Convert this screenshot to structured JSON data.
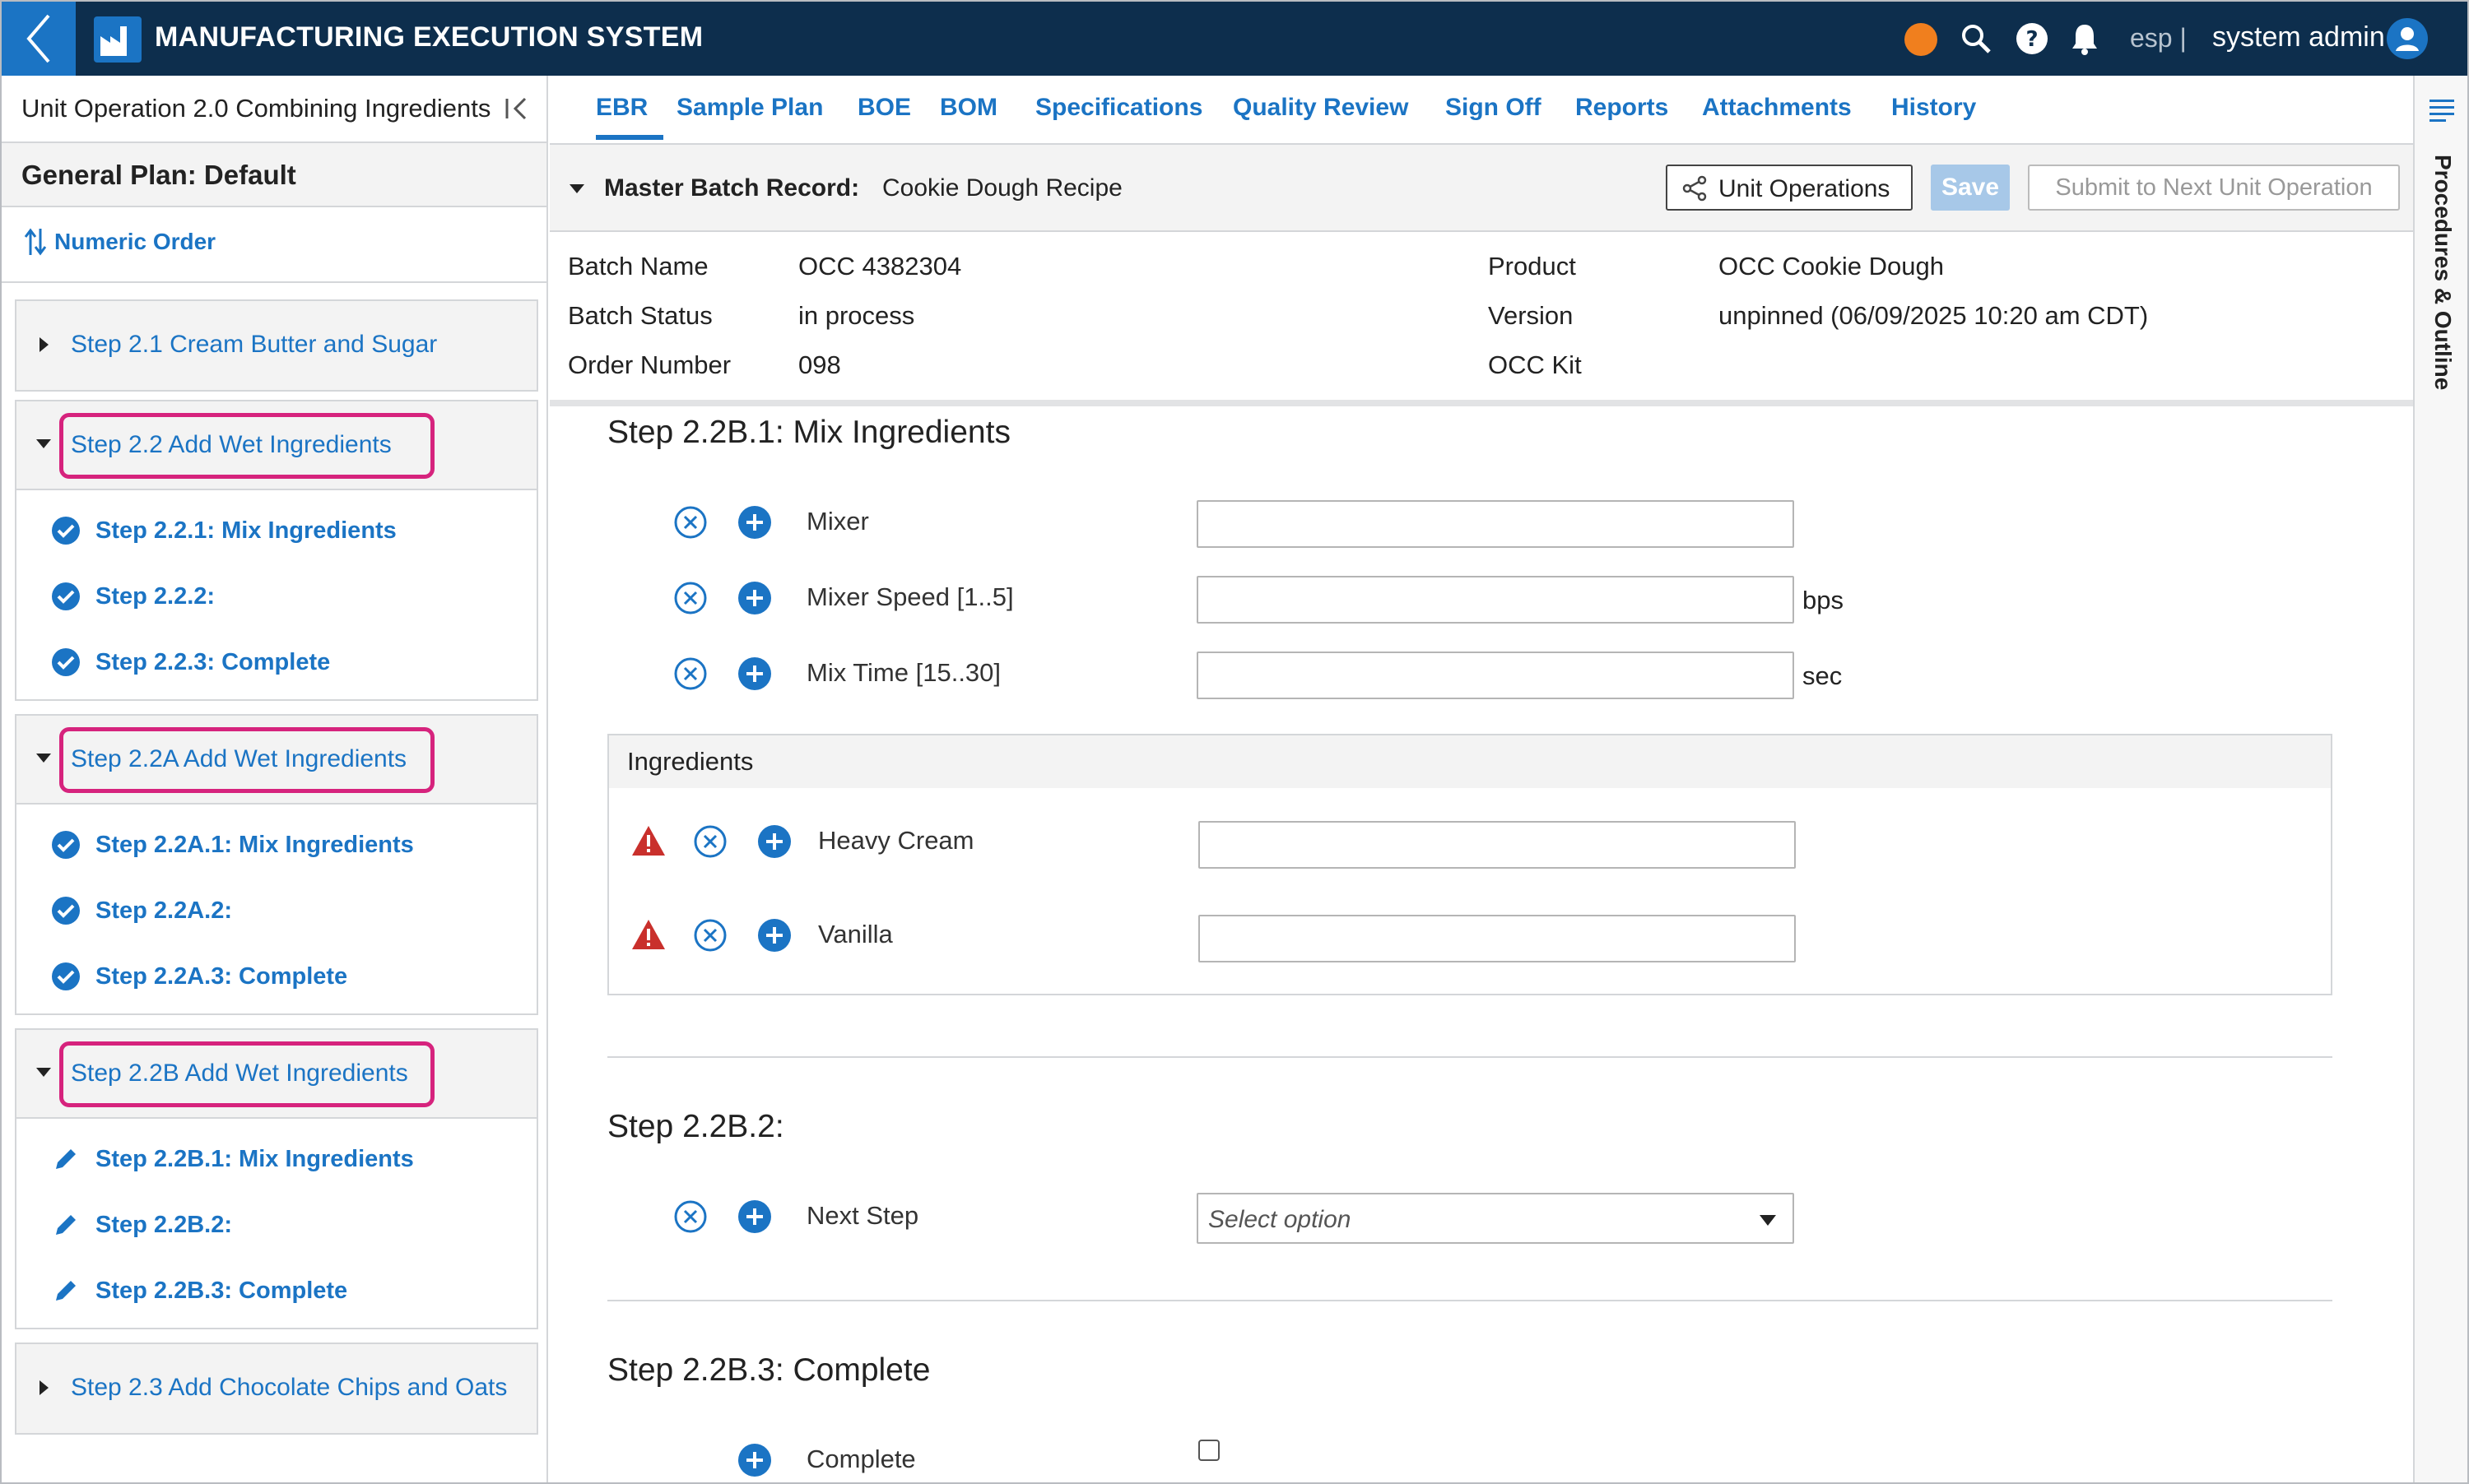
{
  "header": {
    "app_title": "MANUFACTURING EXECUTION SYSTEM",
    "lang": "esp |",
    "user_name": "system admin",
    "status_color": "#f07f1e",
    "accent": "#1b74c4",
    "bar_color": "#0d2e4d"
  },
  "left_panel": {
    "title": "Unit Operation 2.0 Combining Ingredients",
    "plan": "General Plan: Default",
    "order": "Numeric Order",
    "groups": [
      {
        "label": "Step 2.1 Cream Butter and Sugar",
        "items": []
      },
      {
        "label": "Step 2.2 Add Wet Ingredients",
        "items": [
          {
            "label": "Step 2.2.1: Mix Ingredients",
            "icon": "check-circle-icon"
          },
          {
            "label": "Step 2.2.2:",
            "icon": "check-circle-icon"
          },
          {
            "label": "Step 2.2.3: Complete",
            "icon": "check-circle-icon"
          }
        ]
      },
      {
        "label": "Step 2.2A Add Wet Ingredients",
        "items": [
          {
            "label": "Step 2.2A.1: Mix Ingredients",
            "icon": "check-circle-icon"
          },
          {
            "label": "Step 2.2A.2:",
            "icon": "check-circle-icon"
          },
          {
            "label": "Step 2.2A.3: Complete",
            "icon": "check-circle-icon"
          }
        ]
      },
      {
        "label": "Step 2.2B Add Wet Ingredients",
        "items": [
          {
            "label": "Step 2.2B.1: Mix Ingredients",
            "icon": "pencil-icon"
          },
          {
            "label": "Step 2.2B.2:",
            "icon": "pencil-icon"
          },
          {
            "label": "Step 2.2B.3: Complete",
            "icon": "pencil-icon"
          }
        ]
      },
      {
        "label": "Step 2.3 Add Chocolate Chips and Oats",
        "items": []
      }
    ]
  },
  "tabs": [
    "EBR",
    "Sample Plan",
    "BOE",
    "BOM",
    "Specifications",
    "Quality Review",
    "Sign Off",
    "Reports",
    "Attachments",
    "History"
  ],
  "mbr": {
    "label": "Master Batch Record:",
    "value": "Cookie Dough Recipe",
    "unit_ops_button": "Unit Operations",
    "save_button": "Save",
    "submit_button": "Submit to Next Unit Operation"
  },
  "info": {
    "batch_name_label": "Batch Name",
    "batch_name": "OCC 4382304",
    "batch_status_label": "Batch Status",
    "batch_status": "in process",
    "order_number_label": "Order Number",
    "order_number": "098",
    "product_label": "Product",
    "product": "OCC Cookie Dough",
    "version_label": "Version",
    "version": "unpinned (06/09/2025 10:20 am CDT)",
    "kit": "OCC Kit"
  },
  "step1": {
    "title": "Step 2.2B.1: Mix Ingredients",
    "fields": [
      {
        "label": "Mixer",
        "unit": "",
        "value": ""
      },
      {
        "label": "Mixer Speed [1..5]",
        "unit": "bps",
        "value": ""
      },
      {
        "label": "Mix Time [15..30]",
        "unit": "sec",
        "value": ""
      }
    ],
    "ingredients_title": "Ingredients",
    "ingredients": [
      {
        "label": "Heavy Cream",
        "value": ""
      },
      {
        "label": "Vanilla",
        "value": ""
      }
    ]
  },
  "step2": {
    "title": "Step 2.2B.2:",
    "field_label": "Next Step",
    "select_placeholder": "Select option"
  },
  "step3": {
    "title": "Step 2.2B.3: Complete",
    "field_label": "Complete"
  },
  "rail": {
    "label": "Procedures & Outline"
  }
}
